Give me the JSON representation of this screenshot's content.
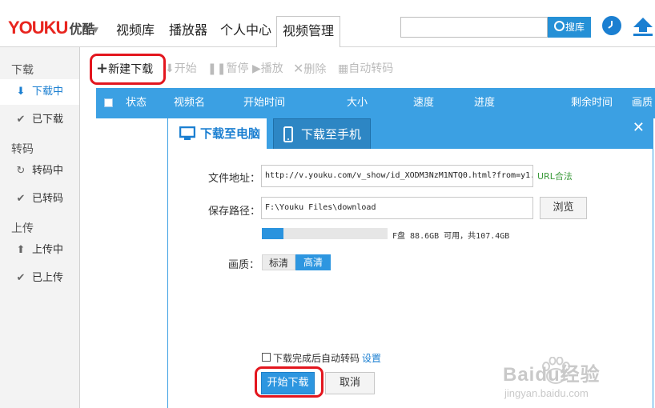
{
  "app": {
    "logo_text": "YOUKU",
    "logo_cn": "优酷"
  },
  "nav": {
    "tabs": [
      {
        "label": "视频库"
      },
      {
        "label": "播放器"
      },
      {
        "label": "个人中心"
      },
      {
        "label": "视频管理",
        "active": true
      }
    ]
  },
  "search": {
    "value": "",
    "button_label": "搜库"
  },
  "sidebar": {
    "sections": [
      {
        "title": "下载",
        "items": [
          {
            "label": "下载中",
            "icon": "download-arrow-icon",
            "active": true
          },
          {
            "label": "已下载",
            "icon": "check-icon"
          }
        ]
      },
      {
        "title": "转码",
        "items": [
          {
            "label": "转码中",
            "icon": "refresh-icon"
          },
          {
            "label": "已转码",
            "icon": "check-icon"
          }
        ]
      },
      {
        "title": "上传",
        "items": [
          {
            "label": "上传中",
            "icon": "upload-arrow-icon"
          },
          {
            "label": "已上传",
            "icon": "check-icon"
          }
        ]
      }
    ]
  },
  "toolbar": {
    "new_download": "新建下载",
    "start": "开始",
    "pause": "暂停",
    "play": "播放",
    "delete": "删除",
    "auto_transcode": "自动转码"
  },
  "table": {
    "columns": [
      "状态",
      "视频名",
      "开始时间",
      "大小",
      "速度",
      "进度",
      "剩余时间",
      "画质"
    ]
  },
  "dialog": {
    "tab_pc": "下载至电脑",
    "tab_phone": "下载至手机",
    "url_label": "文件地址：",
    "url_value": "http://v.youku.com/v_show/id_XODM3NzM1NTQ0.html?from=y1.",
    "url_valid": "URL合法",
    "path_label": "保存路径：",
    "path_value": "F:\\Youku Files\\download",
    "browse": "浏览",
    "disk_info": "F盘  88.6GB 可用，共107.4GB",
    "disk_used_fraction": 0.175,
    "quality_label": "画质：",
    "quality_options": [
      "标清",
      "高清"
    ],
    "quality_selected": "高清",
    "auto_transcode_label": "下载完成后自动转码",
    "settings_link": "设置",
    "start_button": "开始下载",
    "cancel_button": "取消"
  },
  "watermark": {
    "text": "Baidu经验",
    "url": "jingyan.baidu.com"
  },
  "colors": {
    "accent": "#3ba0e3",
    "brand_red": "#e8251f",
    "highlight_ring": "#e3161e",
    "link_green": "#3a9a3a"
  }
}
